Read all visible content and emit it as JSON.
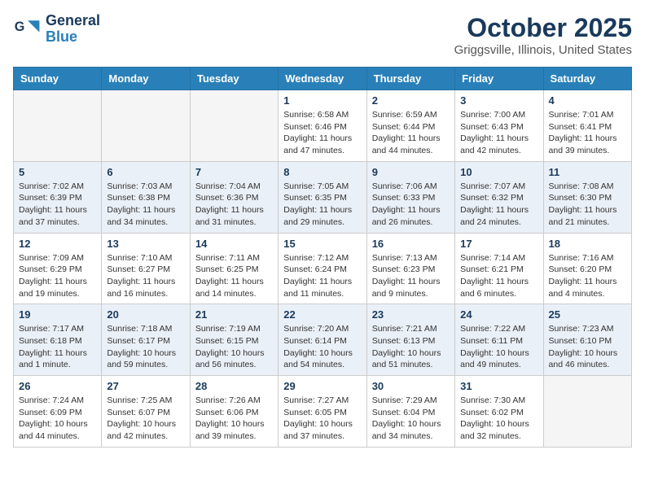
{
  "header": {
    "logo_line1": "General",
    "logo_line2": "Blue",
    "month": "October 2025",
    "location": "Griggsville, Illinois, United States"
  },
  "weekdays": [
    "Sunday",
    "Monday",
    "Tuesday",
    "Wednesday",
    "Thursday",
    "Friday",
    "Saturday"
  ],
  "weeks": [
    [
      {
        "day": "",
        "info": ""
      },
      {
        "day": "",
        "info": ""
      },
      {
        "day": "",
        "info": ""
      },
      {
        "day": "1",
        "info": "Sunrise: 6:58 AM\nSunset: 6:46 PM\nDaylight: 11 hours and 47 minutes."
      },
      {
        "day": "2",
        "info": "Sunrise: 6:59 AM\nSunset: 6:44 PM\nDaylight: 11 hours and 44 minutes."
      },
      {
        "day": "3",
        "info": "Sunrise: 7:00 AM\nSunset: 6:43 PM\nDaylight: 11 hours and 42 minutes."
      },
      {
        "day": "4",
        "info": "Sunrise: 7:01 AM\nSunset: 6:41 PM\nDaylight: 11 hours and 39 minutes."
      }
    ],
    [
      {
        "day": "5",
        "info": "Sunrise: 7:02 AM\nSunset: 6:39 PM\nDaylight: 11 hours and 37 minutes."
      },
      {
        "day": "6",
        "info": "Sunrise: 7:03 AM\nSunset: 6:38 PM\nDaylight: 11 hours and 34 minutes."
      },
      {
        "day": "7",
        "info": "Sunrise: 7:04 AM\nSunset: 6:36 PM\nDaylight: 11 hours and 31 minutes."
      },
      {
        "day": "8",
        "info": "Sunrise: 7:05 AM\nSunset: 6:35 PM\nDaylight: 11 hours and 29 minutes."
      },
      {
        "day": "9",
        "info": "Sunrise: 7:06 AM\nSunset: 6:33 PM\nDaylight: 11 hours and 26 minutes."
      },
      {
        "day": "10",
        "info": "Sunrise: 7:07 AM\nSunset: 6:32 PM\nDaylight: 11 hours and 24 minutes."
      },
      {
        "day": "11",
        "info": "Sunrise: 7:08 AM\nSunset: 6:30 PM\nDaylight: 11 hours and 21 minutes."
      }
    ],
    [
      {
        "day": "12",
        "info": "Sunrise: 7:09 AM\nSunset: 6:29 PM\nDaylight: 11 hours and 19 minutes."
      },
      {
        "day": "13",
        "info": "Sunrise: 7:10 AM\nSunset: 6:27 PM\nDaylight: 11 hours and 16 minutes."
      },
      {
        "day": "14",
        "info": "Sunrise: 7:11 AM\nSunset: 6:25 PM\nDaylight: 11 hours and 14 minutes."
      },
      {
        "day": "15",
        "info": "Sunrise: 7:12 AM\nSunset: 6:24 PM\nDaylight: 11 hours and 11 minutes."
      },
      {
        "day": "16",
        "info": "Sunrise: 7:13 AM\nSunset: 6:23 PM\nDaylight: 11 hours and 9 minutes."
      },
      {
        "day": "17",
        "info": "Sunrise: 7:14 AM\nSunset: 6:21 PM\nDaylight: 11 hours and 6 minutes."
      },
      {
        "day": "18",
        "info": "Sunrise: 7:16 AM\nSunset: 6:20 PM\nDaylight: 11 hours and 4 minutes."
      }
    ],
    [
      {
        "day": "19",
        "info": "Sunrise: 7:17 AM\nSunset: 6:18 PM\nDaylight: 11 hours and 1 minute."
      },
      {
        "day": "20",
        "info": "Sunrise: 7:18 AM\nSunset: 6:17 PM\nDaylight: 10 hours and 59 minutes."
      },
      {
        "day": "21",
        "info": "Sunrise: 7:19 AM\nSunset: 6:15 PM\nDaylight: 10 hours and 56 minutes."
      },
      {
        "day": "22",
        "info": "Sunrise: 7:20 AM\nSunset: 6:14 PM\nDaylight: 10 hours and 54 minutes."
      },
      {
        "day": "23",
        "info": "Sunrise: 7:21 AM\nSunset: 6:13 PM\nDaylight: 10 hours and 51 minutes."
      },
      {
        "day": "24",
        "info": "Sunrise: 7:22 AM\nSunset: 6:11 PM\nDaylight: 10 hours and 49 minutes."
      },
      {
        "day": "25",
        "info": "Sunrise: 7:23 AM\nSunset: 6:10 PM\nDaylight: 10 hours and 46 minutes."
      }
    ],
    [
      {
        "day": "26",
        "info": "Sunrise: 7:24 AM\nSunset: 6:09 PM\nDaylight: 10 hours and 44 minutes."
      },
      {
        "day": "27",
        "info": "Sunrise: 7:25 AM\nSunset: 6:07 PM\nDaylight: 10 hours and 42 minutes."
      },
      {
        "day": "28",
        "info": "Sunrise: 7:26 AM\nSunset: 6:06 PM\nDaylight: 10 hours and 39 minutes."
      },
      {
        "day": "29",
        "info": "Sunrise: 7:27 AM\nSunset: 6:05 PM\nDaylight: 10 hours and 37 minutes."
      },
      {
        "day": "30",
        "info": "Sunrise: 7:29 AM\nSunset: 6:04 PM\nDaylight: 10 hours and 34 minutes."
      },
      {
        "day": "31",
        "info": "Sunrise: 7:30 AM\nSunset: 6:02 PM\nDaylight: 10 hours and 32 minutes."
      },
      {
        "day": "",
        "info": ""
      }
    ]
  ]
}
